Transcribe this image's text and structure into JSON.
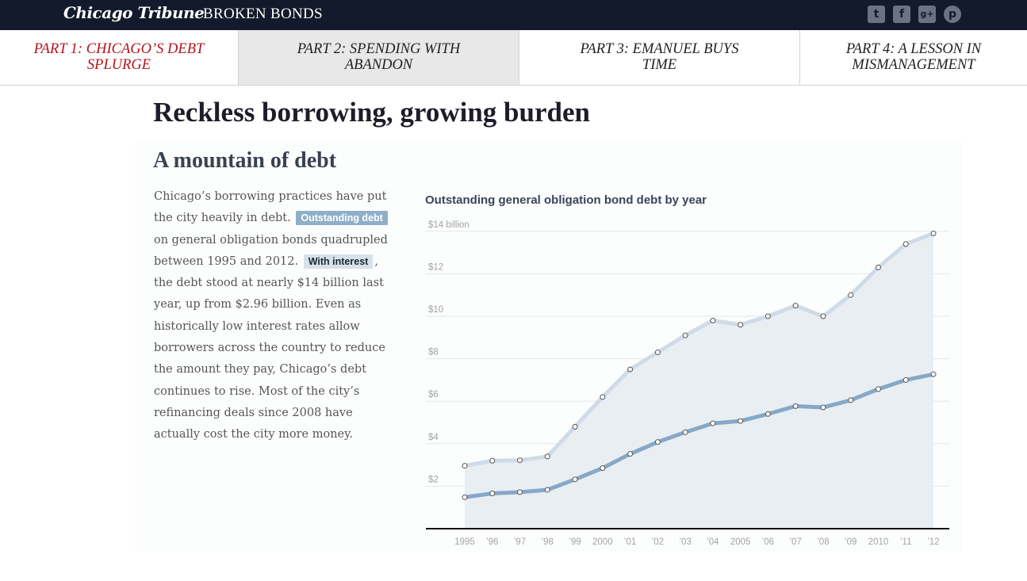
{
  "header": {
    "logo": "Chicago Tribune",
    "section": "BROKEN BONDS",
    "social_icons": [
      "twitter-icon",
      "facebook-icon",
      "google-plus-icon",
      "pinterest-icon"
    ]
  },
  "parts": [
    {
      "line1": "PART 1: CHICAGO’S DEBT",
      "line2": "SPLURGE"
    },
    {
      "line1": "PART 2: SPENDING WITH",
      "line2": "ABANDON"
    },
    {
      "line1": "PART 3: EMANUEL BUYS",
      "line2": "TIME"
    },
    {
      "line1": "PART 4: A LESSON IN",
      "line2": "MISMANAGEMENT"
    }
  ],
  "headline": "Reckless borrowing, growing burden",
  "subhead": "A mountain of debt",
  "body": {
    "p1": "Chicago’s borrowing practices have put the city heavily in debt.",
    "tag_outstanding": "Outstanding debt",
    "p2": "on general obligation bonds quadrupled between 1995 and 2012.",
    "tag_interest": "With interest",
    "p3": ", the debt stood at nearly $14 billion last year, up from $2.96 billion. Even as historically low interest rates allow borrowers across the country to reduce the amount they pay, Chicago’s debt continues to rise. Most of the city’s refinancing deals since 2008 have actually cost the city more money."
  },
  "colors": {
    "accent_red": "#b3141b",
    "outstanding_line": "#86a8c7",
    "interest_line": "#cfdbe6",
    "area_fill": "#e9eef3",
    "topbar": "#131a2b"
  },
  "chart_data": {
    "type": "area",
    "title": "Outstanding general obligation bond debt by year",
    "x": [
      "1995",
      "’96",
      "’97",
      "’98",
      "’99",
      "2000",
      "’01",
      "’02",
      "’03",
      "’04",
      "2005",
      "’06",
      "’07",
      "’08",
      "’09",
      "2010",
      "’11",
      "’12"
    ],
    "y_ticks": [
      "$2",
      "$4",
      "$6",
      "$8",
      "$10",
      "$12",
      "$14 billion"
    ],
    "ylim": [
      0,
      14
    ],
    "series": [
      {
        "name": "With interest",
        "values": [
          2.96,
          3.2,
          3.22,
          3.4,
          4.8,
          6.2,
          7.5,
          8.3,
          9.1,
          9.8,
          9.6,
          10.0,
          10.5,
          10.0,
          11.0,
          12.3,
          13.4,
          13.9
        ]
      },
      {
        "name": "Outstanding debt",
        "values": [
          1.48,
          1.66,
          1.72,
          1.83,
          2.32,
          2.85,
          3.52,
          4.08,
          4.54,
          4.96,
          5.07,
          5.4,
          5.77,
          5.71,
          6.05,
          6.57,
          7.0,
          7.27
        ]
      }
    ],
    "grid": true
  }
}
